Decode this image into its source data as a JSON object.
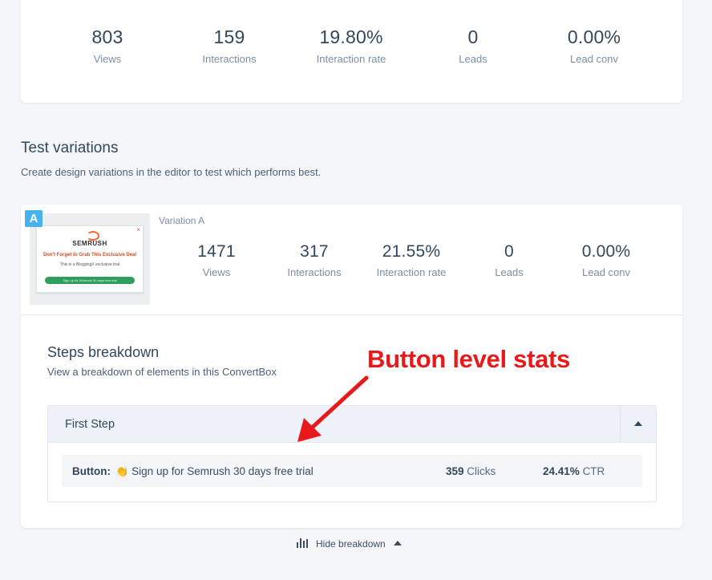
{
  "summary_stats": [
    {
      "value": "803",
      "label": "Views"
    },
    {
      "value": "159",
      "label": "Interactions"
    },
    {
      "value": "19.80%",
      "label": "Interaction rate"
    },
    {
      "value": "0",
      "label": "Leads"
    },
    {
      "value": "0.00%",
      "label": "Lead conv"
    }
  ],
  "test_variations": {
    "title": "Test variations",
    "subtitle": "Create design variations in the editor to test which performs best."
  },
  "variation": {
    "badge": "A",
    "name": "Variation A",
    "thumbnail": {
      "close": "×",
      "logo": "SEMRUSH",
      "headline": "Don't Forget to Grab This Exclusive Deal",
      "line": "This is a BloggingX exclusive trial",
      "button": "Sign up for Semrush 30 days free trial"
    },
    "stats": [
      {
        "value": "1471",
        "label": "Views"
      },
      {
        "value": "317",
        "label": "Interactions"
      },
      {
        "value": "21.55%",
        "label": "Interaction rate"
      },
      {
        "value": "0",
        "label": "Leads"
      },
      {
        "value": "0.00%",
        "label": "Lead conv"
      }
    ]
  },
  "steps_breakdown": {
    "title": "Steps breakdown",
    "subtitle": "View a breakdown of elements in this ConvertBox",
    "step_name": "First Step",
    "button_row": {
      "prefix": "Button:",
      "emoji": "👏",
      "text": "Sign up for Semrush 30 days free trial",
      "clicks_value": "359",
      "clicks_label": "Clicks",
      "ctr_value": "24.41%",
      "ctr_label": "CTR"
    }
  },
  "hide_breakdown_label": "Hide breakdown",
  "annotation": "Button level stats",
  "colors": {
    "accent": "#46b3f0",
    "annotation": "#e8191b",
    "text": "#33475b"
  },
  "icons": [
    "bars-chart-icon",
    "chevron-up-icon",
    "clap-icon",
    "semrush-logo-icon"
  ]
}
